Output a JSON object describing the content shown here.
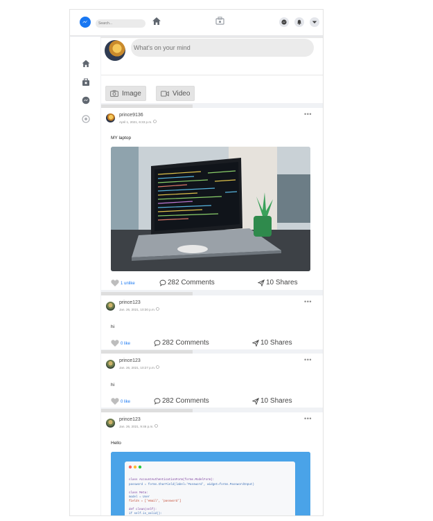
{
  "header": {
    "search_placeholder": "Search..."
  },
  "composer": {
    "placeholder": "What's on your mind",
    "image_label": "Image",
    "video_label": "Video"
  },
  "posts": [
    {
      "username": "prince9136",
      "date": "April 1, 2021, 6:33 p.m.",
      "text": "MY laptop",
      "likes": "1 unlike",
      "comments": "282 Comments",
      "shares": "10 Shares"
    },
    {
      "username": "prince123",
      "date": "Jan. 26, 2021, 10:30 p.m.",
      "text": "hi",
      "likes": "0 like",
      "comments": "282 Comments",
      "shares": "10 Shares"
    },
    {
      "username": "prince123",
      "date": "Jan. 26, 2021, 10:27 p.m.",
      "text": "hi",
      "likes": "0 like",
      "comments": "282 Comments",
      "shares": "10 Shares"
    },
    {
      "username": "prince123",
      "date": "Jan. 26, 2021, 9:46 p.m.",
      "text": "Hello"
    }
  ],
  "code_snippet": {
    "lines": [
      "class AccountAuthenticationForm(forms.ModelForm):",
      "    password = forms.CharField(label='Password', widget=forms.PasswordInput)",
      "    class Meta:",
      "        model = User",
      "        fields = ['email', 'password']",
      "    def clean(self):",
      "        if self.is_valid():"
    ]
  },
  "colors": {
    "brand": "#1877f2",
    "like_text": "#1877f2"
  }
}
